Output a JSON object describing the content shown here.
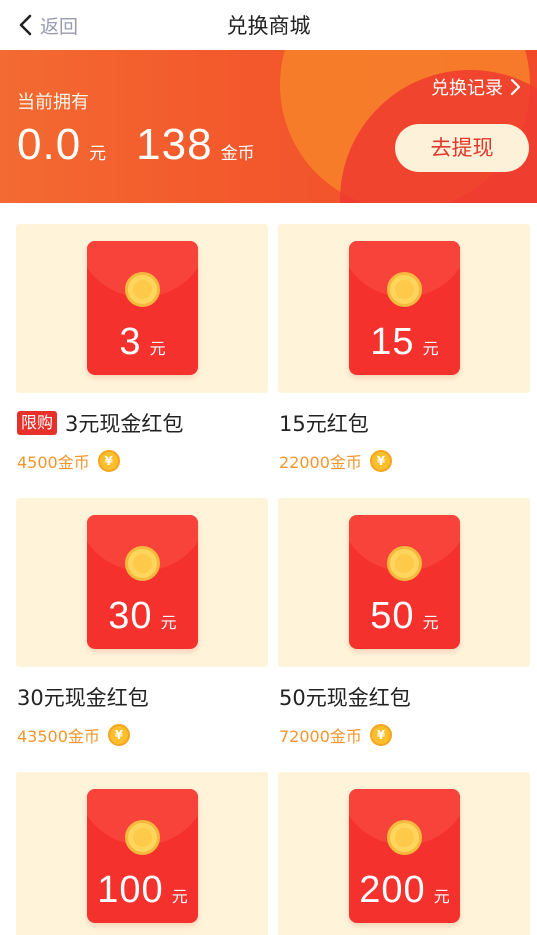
{
  "nav": {
    "back_label": "返回",
    "title": "兑换商城"
  },
  "banner": {
    "label": "当前拥有",
    "balance_yuan": "0.0",
    "yuan_unit": "元",
    "coins": "138",
    "coin_unit": "金币",
    "record_label": "兑换记录",
    "withdraw_label": "去提现"
  },
  "products": [
    {
      "amount": "3",
      "unit": "元",
      "tag": "限购",
      "name": "3元现金红包",
      "price": "4500金币"
    },
    {
      "amount": "15",
      "unit": "元",
      "tag": "",
      "name": "15元红包",
      "price": "22000金币"
    },
    {
      "amount": "30",
      "unit": "元",
      "tag": "",
      "name": "30元现金红包",
      "price": "43500金币"
    },
    {
      "amount": "50",
      "unit": "元",
      "tag": "",
      "name": "50元现金红包",
      "price": "72000金币"
    },
    {
      "amount": "100",
      "unit": "元",
      "tag": "",
      "name": "",
      "price": ""
    },
    {
      "amount": "200",
      "unit": "元",
      "tag": "",
      "name": "",
      "price": ""
    }
  ],
  "icons": {
    "back": "chevron-left-icon",
    "record": "chevron-right-icon",
    "coin": "yen-coin-icon",
    "coin_glyph": "¥"
  },
  "colors": {
    "banner": "#f35a2c",
    "accent_red": "#e8302a",
    "price": "#f5962d",
    "card_bg": "#fff4da"
  }
}
